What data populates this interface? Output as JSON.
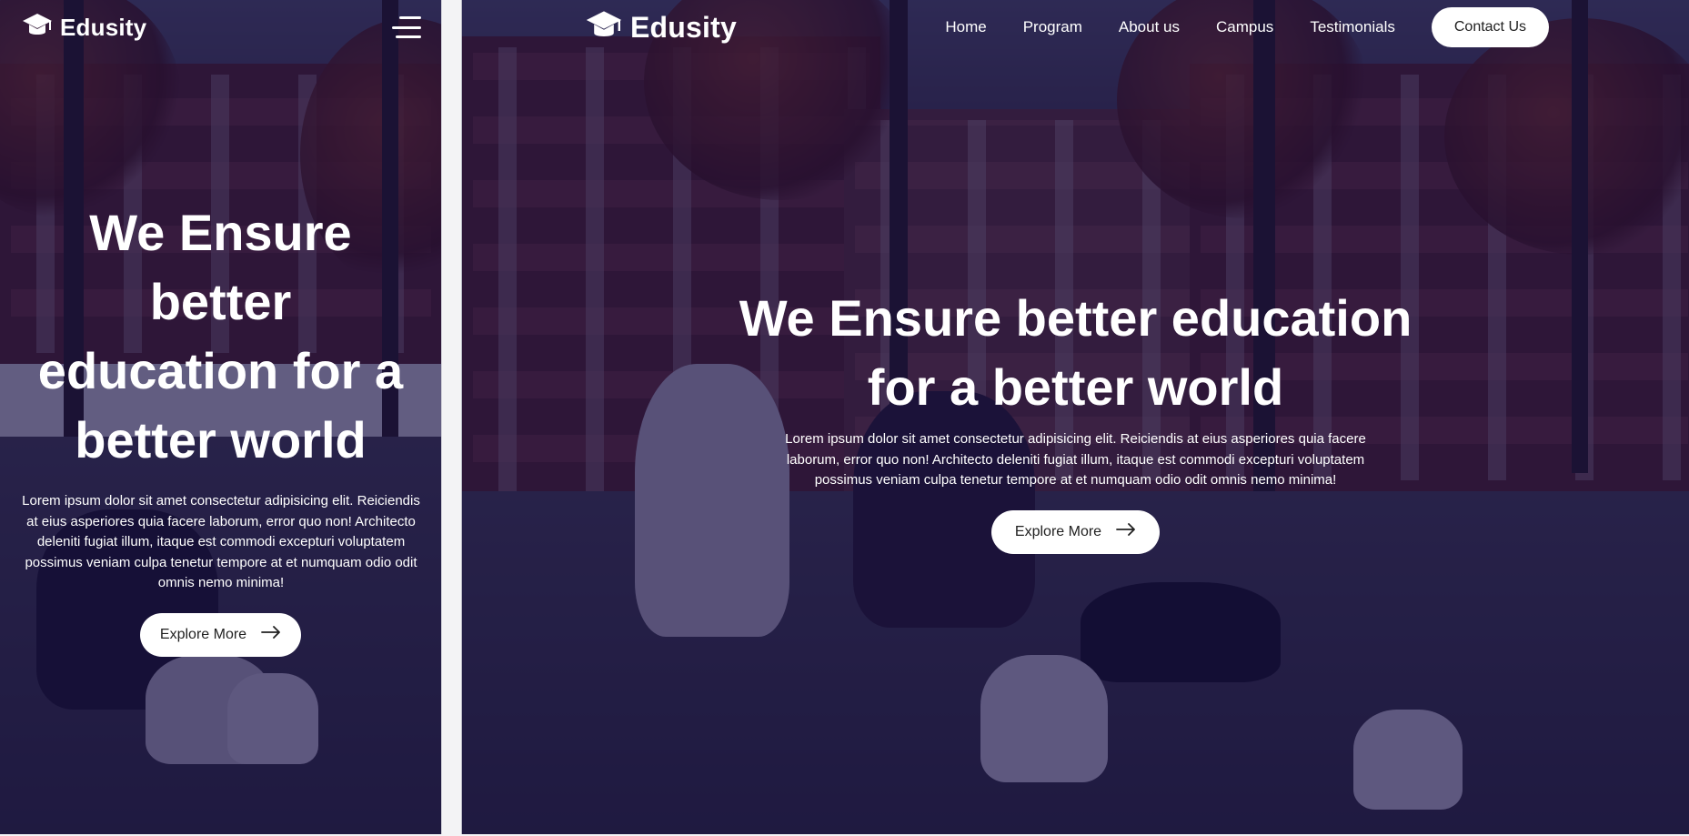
{
  "brand": {
    "name": "Edusity",
    "logo_icon": "graduation-cap-icon"
  },
  "nav": {
    "links": [
      "Home",
      "Program",
      "About us",
      "Campus",
      "Testimonials"
    ],
    "contact_label": "Contact Us",
    "menu_icon": "hamburger-menu-icon"
  },
  "hero": {
    "title": "We Ensure better education for a better world",
    "description": "Lorem ipsum dolor sit amet consectetur adipisicing elit. Reiciendis at eius asperiores quia facere laborum, error quo non! Architecto deleniti fugiat illum, itaque est commodi excepturi voluptatem possimus veniam culpa tenetur tempore at et numquam odio odit omnis nemo minima!",
    "button_label": "Explore More",
    "button_icon": "arrow-right-icon"
  },
  "colors": {
    "overlay": "#08003a",
    "text": "#ffffff",
    "button_bg": "#ffffff",
    "button_text": "#212121"
  }
}
